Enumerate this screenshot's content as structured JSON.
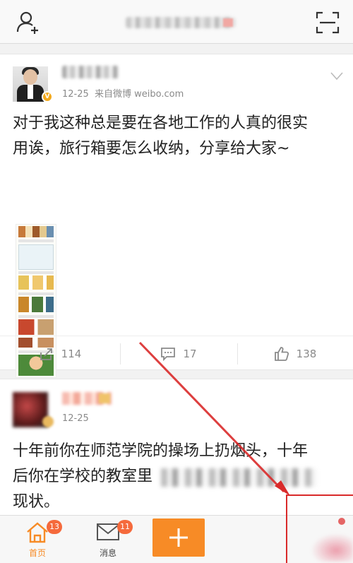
{
  "topbar": {
    "title": "",
    "icons": {
      "left": "add-friend-icon",
      "right": "scan-icon"
    }
  },
  "post1": {
    "author": "",
    "verified_badge": "V",
    "time": "12-25",
    "source": "来自微博 weibo.com",
    "text_line1": "对于我这种总是要在各地工作的人真的很实",
    "text_line2": "用诶，旅行箱要怎么收纳，分享给大家~",
    "actions": {
      "repost": "114",
      "comment": "17",
      "like": "138"
    }
  },
  "post2": {
    "author": "",
    "time": "12-25",
    "line1": "十年前你在师范学院的操场上扔烟头，十年",
    "line2": "后你在学校的教室里",
    "line3": "现状。"
  },
  "tabbar": {
    "home": {
      "label": "首页",
      "badge": "13"
    },
    "messages": {
      "label": "消息",
      "badge": "11"
    },
    "compose_icon": "plus-icon"
  },
  "colors": {
    "accent": "#f78b26",
    "badge": "#f56a3c",
    "annotation": "#d92a2a"
  }
}
